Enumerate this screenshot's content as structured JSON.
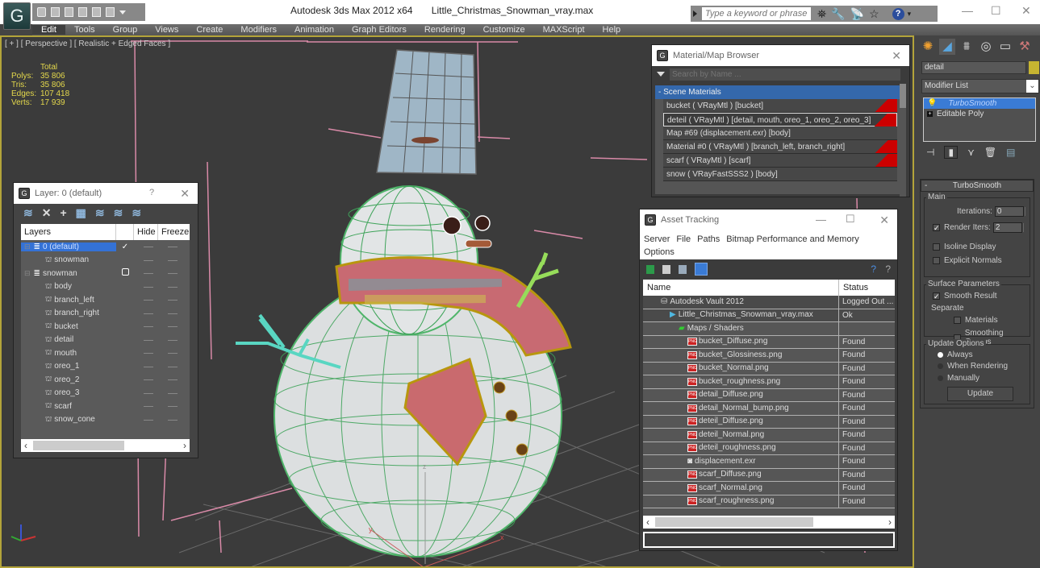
{
  "titlebar": {
    "app_name": "Autodesk 3ds Max  2012 x64",
    "file_name": "Little_Christmas_Snowman_vray.max",
    "search_placeholder": "Type a keyword or phrase",
    "minimize": "—",
    "maximize": "☐",
    "close": "✕"
  },
  "menubar": {
    "items": [
      "Edit",
      "Tools",
      "Group",
      "Views",
      "Create",
      "Modifiers",
      "Animation",
      "Graph Editors",
      "Rendering",
      "Customize",
      "MAXScript",
      "Help"
    ]
  },
  "viewport": {
    "label": "[ + ] [ Perspective ] [ Realistic + Edged Faces ]",
    "stats": {
      "header": "Total",
      "rows": [
        {
          "key": "Polys:",
          "value": "35 806"
        },
        {
          "key": "Tris:",
          "value": "35 806"
        },
        {
          "key": "Edges:",
          "value": "107 418"
        },
        {
          "key": "Verts:",
          "value": "17 939"
        }
      ]
    },
    "gizmo_labels": {
      "z": "z",
      "y": "y",
      "x": "x"
    }
  },
  "layer_dialog": {
    "title": "Layer: 0 (default)",
    "help": "?",
    "close": "✕",
    "columns": [
      "Layers",
      "Hide",
      "Freeze"
    ],
    "rows": [
      {
        "name": "0 (default)",
        "type": "layer",
        "selected": true,
        "current": "✓"
      },
      {
        "name": "snowman",
        "type": "object",
        "indent": 1
      },
      {
        "name": "snowman",
        "type": "layer",
        "box": true
      },
      {
        "name": "body",
        "type": "object",
        "indent": 1
      },
      {
        "name": "branch_left",
        "type": "object",
        "indent": 1
      },
      {
        "name": "branch_right",
        "type": "object",
        "indent": 1
      },
      {
        "name": "bucket",
        "type": "object",
        "indent": 1
      },
      {
        "name": "detail",
        "type": "object",
        "indent": 1
      },
      {
        "name": "mouth",
        "type": "object",
        "indent": 1
      },
      {
        "name": "oreo_1",
        "type": "object",
        "indent": 1
      },
      {
        "name": "oreo_2",
        "type": "object",
        "indent": 1
      },
      {
        "name": "oreo_3",
        "type": "object",
        "indent": 1
      },
      {
        "name": "scarf",
        "type": "object",
        "indent": 1
      },
      {
        "name": "snow_cone",
        "type": "object",
        "indent": 1
      }
    ]
  },
  "material_browser": {
    "title": "Material/Map Browser",
    "close": "✕",
    "search_placeholder": "Search by Name ...",
    "category": "- Scene Materials",
    "items": [
      {
        "label": "bucket  ( VRayMtl ) [bucket]",
        "flag": true
      },
      {
        "label": "deteil  ( VRayMtl ) [detail, mouth, oreo_1, oreo_2, oreo_3]",
        "flag": true,
        "selected": true
      },
      {
        "label": "Map #69 (displacement.exr) [body]",
        "flag": false
      },
      {
        "label": "Material #0  ( VRayMtl ) [branch_left, branch_right]",
        "flag": true
      },
      {
        "label": "scarf  ( VRayMtl ) [scarf]",
        "flag": true
      },
      {
        "label": "snow  ( VRayFastSSS2 ) [body]",
        "flag": false
      }
    ]
  },
  "asset_tracking": {
    "title": "Asset Tracking",
    "minimize": "—",
    "maximize": "☐",
    "close": "✕",
    "menu": [
      "Server",
      "File",
      "Paths",
      "Bitmap Performance and Memory",
      "Options"
    ],
    "columns": [
      "Name",
      "Status"
    ],
    "rows": [
      {
        "name": "Autodesk Vault 2012",
        "status": "Logged Out ...",
        "indent": 2,
        "icon": "vault"
      },
      {
        "name": "Little_Christmas_Snowman_vray.max",
        "status": "Ok",
        "indent": 3,
        "icon": "max"
      },
      {
        "name": "Maps / Shaders",
        "status": "",
        "indent": 4,
        "icon": "maps"
      },
      {
        "name": "bucket_Diffuse.png",
        "status": "Found",
        "indent": 5,
        "icon": "png"
      },
      {
        "name": "bucket_Glossiness.png",
        "status": "Found",
        "indent": 5,
        "icon": "png"
      },
      {
        "name": "bucket_Normal.png",
        "status": "Found",
        "indent": 5,
        "icon": "png"
      },
      {
        "name": "bucket_roughness.png",
        "status": "Found",
        "indent": 5,
        "icon": "png"
      },
      {
        "name": "detail_Diffuse.png",
        "status": "Found",
        "indent": 5,
        "icon": "png"
      },
      {
        "name": "detail_Normal_bump.png",
        "status": "Found",
        "indent": 5,
        "icon": "png"
      },
      {
        "name": "deteil_Diffuse.png",
        "status": "Found",
        "indent": 5,
        "icon": "png"
      },
      {
        "name": "deteil_Normal.png",
        "status": "Found",
        "indent": 5,
        "icon": "png"
      },
      {
        "name": "deteil_roughness.png",
        "status": "Found",
        "indent": 5,
        "icon": "png"
      },
      {
        "name": "displacement.exr",
        "status": "Found",
        "indent": 5,
        "icon": "exr"
      },
      {
        "name": "scarf_Diffuse.png",
        "status": "Found",
        "indent": 5,
        "icon": "png"
      },
      {
        "name": "scarf_Normal.png",
        "status": "Found",
        "indent": 5,
        "icon": "png"
      },
      {
        "name": "scarf_roughness.png",
        "status": "Found",
        "indent": 5,
        "icon": "png"
      }
    ]
  },
  "command_panel": {
    "object_name": "detail",
    "object_color": "#c6b431",
    "modifier_list": "Modifier List",
    "stack": [
      {
        "label": "TurboSmooth",
        "selected": true
      },
      {
        "label": "Editable Poly",
        "selected": false
      }
    ],
    "turbosmooth": {
      "title": "TurboSmooth",
      "main_group": "Main",
      "iterations_label": "Iterations:",
      "iterations": "0",
      "render_iters_label": "Render Iters:",
      "render_iters": "2",
      "render_iters_checked": true,
      "isoline_label": "Isoline Display",
      "explicit_normals_label": "Explicit Normals",
      "surface_group": "Surface Parameters",
      "smooth_result_label": "Smooth Result",
      "separate_label": "Separate",
      "materials_label": "Materials",
      "smoothing_groups_label": "Smoothing Groups",
      "update_group": "Update Options",
      "always_label": "Always",
      "when_rendering_label": "When Rendering",
      "manually_label": "Manually",
      "update_button": "Update"
    }
  }
}
